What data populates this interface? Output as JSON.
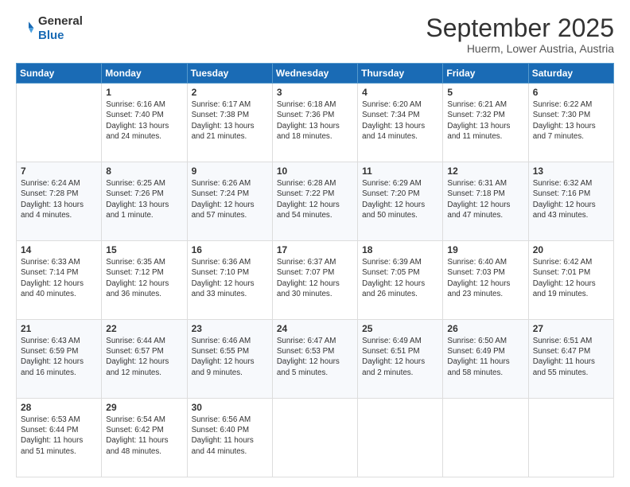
{
  "header": {
    "logo": {
      "line1": "General",
      "line2": "Blue"
    },
    "title": "September 2025",
    "subtitle": "Huerm, Lower Austria, Austria"
  },
  "weekdays": [
    "Sunday",
    "Monday",
    "Tuesday",
    "Wednesday",
    "Thursday",
    "Friday",
    "Saturday"
  ],
  "weeks": [
    [
      {
        "day": "",
        "info": ""
      },
      {
        "day": "1",
        "info": "Sunrise: 6:16 AM\nSunset: 7:40 PM\nDaylight: 13 hours\nand 24 minutes."
      },
      {
        "day": "2",
        "info": "Sunrise: 6:17 AM\nSunset: 7:38 PM\nDaylight: 13 hours\nand 21 minutes."
      },
      {
        "day": "3",
        "info": "Sunrise: 6:18 AM\nSunset: 7:36 PM\nDaylight: 13 hours\nand 18 minutes."
      },
      {
        "day": "4",
        "info": "Sunrise: 6:20 AM\nSunset: 7:34 PM\nDaylight: 13 hours\nand 14 minutes."
      },
      {
        "day": "5",
        "info": "Sunrise: 6:21 AM\nSunset: 7:32 PM\nDaylight: 13 hours\nand 11 minutes."
      },
      {
        "day": "6",
        "info": "Sunrise: 6:22 AM\nSunset: 7:30 PM\nDaylight: 13 hours\nand 7 minutes."
      }
    ],
    [
      {
        "day": "7",
        "info": "Sunrise: 6:24 AM\nSunset: 7:28 PM\nDaylight: 13 hours\nand 4 minutes."
      },
      {
        "day": "8",
        "info": "Sunrise: 6:25 AM\nSunset: 7:26 PM\nDaylight: 13 hours\nand 1 minute."
      },
      {
        "day": "9",
        "info": "Sunrise: 6:26 AM\nSunset: 7:24 PM\nDaylight: 12 hours\nand 57 minutes."
      },
      {
        "day": "10",
        "info": "Sunrise: 6:28 AM\nSunset: 7:22 PM\nDaylight: 12 hours\nand 54 minutes."
      },
      {
        "day": "11",
        "info": "Sunrise: 6:29 AM\nSunset: 7:20 PM\nDaylight: 12 hours\nand 50 minutes."
      },
      {
        "day": "12",
        "info": "Sunrise: 6:31 AM\nSunset: 7:18 PM\nDaylight: 12 hours\nand 47 minutes."
      },
      {
        "day": "13",
        "info": "Sunrise: 6:32 AM\nSunset: 7:16 PM\nDaylight: 12 hours\nand 43 minutes."
      }
    ],
    [
      {
        "day": "14",
        "info": "Sunrise: 6:33 AM\nSunset: 7:14 PM\nDaylight: 12 hours\nand 40 minutes."
      },
      {
        "day": "15",
        "info": "Sunrise: 6:35 AM\nSunset: 7:12 PM\nDaylight: 12 hours\nand 36 minutes."
      },
      {
        "day": "16",
        "info": "Sunrise: 6:36 AM\nSunset: 7:10 PM\nDaylight: 12 hours\nand 33 minutes."
      },
      {
        "day": "17",
        "info": "Sunrise: 6:37 AM\nSunset: 7:07 PM\nDaylight: 12 hours\nand 30 minutes."
      },
      {
        "day": "18",
        "info": "Sunrise: 6:39 AM\nSunset: 7:05 PM\nDaylight: 12 hours\nand 26 minutes."
      },
      {
        "day": "19",
        "info": "Sunrise: 6:40 AM\nSunset: 7:03 PM\nDaylight: 12 hours\nand 23 minutes."
      },
      {
        "day": "20",
        "info": "Sunrise: 6:42 AM\nSunset: 7:01 PM\nDaylight: 12 hours\nand 19 minutes."
      }
    ],
    [
      {
        "day": "21",
        "info": "Sunrise: 6:43 AM\nSunset: 6:59 PM\nDaylight: 12 hours\nand 16 minutes."
      },
      {
        "day": "22",
        "info": "Sunrise: 6:44 AM\nSunset: 6:57 PM\nDaylight: 12 hours\nand 12 minutes."
      },
      {
        "day": "23",
        "info": "Sunrise: 6:46 AM\nSunset: 6:55 PM\nDaylight: 12 hours\nand 9 minutes."
      },
      {
        "day": "24",
        "info": "Sunrise: 6:47 AM\nSunset: 6:53 PM\nDaylight: 12 hours\nand 5 minutes."
      },
      {
        "day": "25",
        "info": "Sunrise: 6:49 AM\nSunset: 6:51 PM\nDaylight: 12 hours\nand 2 minutes."
      },
      {
        "day": "26",
        "info": "Sunrise: 6:50 AM\nSunset: 6:49 PM\nDaylight: 11 hours\nand 58 minutes."
      },
      {
        "day": "27",
        "info": "Sunrise: 6:51 AM\nSunset: 6:47 PM\nDaylight: 11 hours\nand 55 minutes."
      }
    ],
    [
      {
        "day": "28",
        "info": "Sunrise: 6:53 AM\nSunset: 6:44 PM\nDaylight: 11 hours\nand 51 minutes."
      },
      {
        "day": "29",
        "info": "Sunrise: 6:54 AM\nSunset: 6:42 PM\nDaylight: 11 hours\nand 48 minutes."
      },
      {
        "day": "30",
        "info": "Sunrise: 6:56 AM\nSunset: 6:40 PM\nDaylight: 11 hours\nand 44 minutes."
      },
      {
        "day": "",
        "info": ""
      },
      {
        "day": "",
        "info": ""
      },
      {
        "day": "",
        "info": ""
      },
      {
        "day": "",
        "info": ""
      }
    ]
  ]
}
